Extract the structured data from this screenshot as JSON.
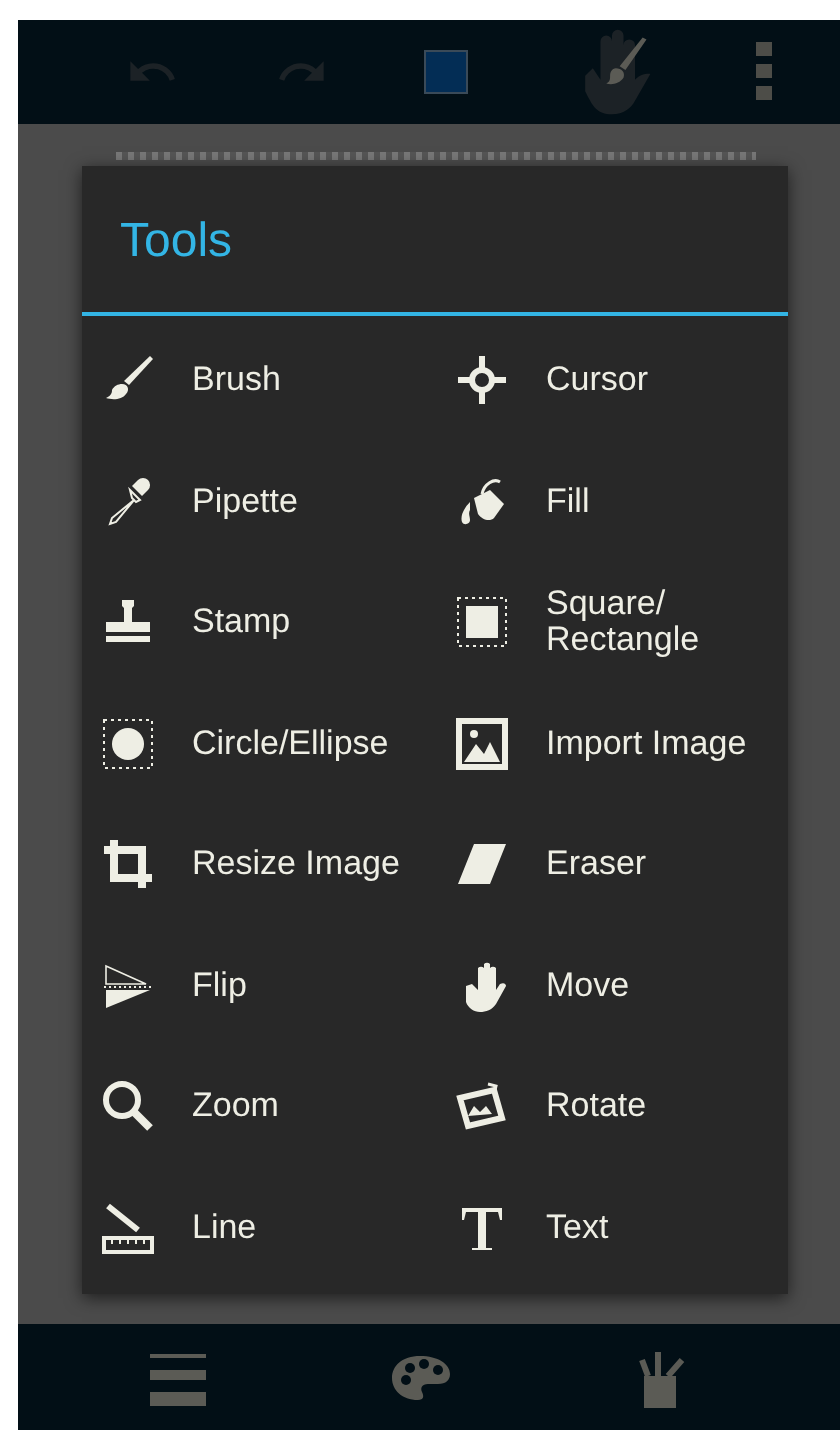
{
  "dialog": {
    "title": "Tools"
  },
  "tools": [
    {
      "label": "Brush"
    },
    {
      "label": "Cursor"
    },
    {
      "label": "Pipette"
    },
    {
      "label": "Fill"
    },
    {
      "label": "Stamp"
    },
    {
      "label": "Square/\nRectangle"
    },
    {
      "label": "Circle/Ellipse"
    },
    {
      "label": "Import Image"
    },
    {
      "label": "Resize Image"
    },
    {
      "label": "Eraser"
    },
    {
      "label": "Flip"
    },
    {
      "label": "Move"
    },
    {
      "label": "Zoom"
    },
    {
      "label": "Rotate"
    },
    {
      "label": "Line"
    },
    {
      "label": "Text"
    }
  ]
}
